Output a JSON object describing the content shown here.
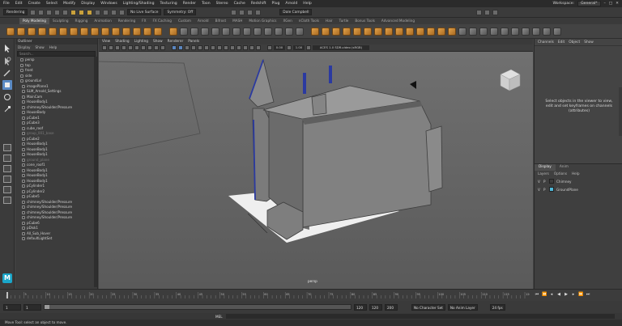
{
  "menubar": {
    "items": [
      "File",
      "Edit",
      "Create",
      "Select",
      "Modify",
      "Display",
      "Windows",
      "Lighting/Shading",
      "Texturing",
      "Render",
      "Toon",
      "Stereo",
      "Cache",
      "Redshift",
      "Plug",
      "Arnold",
      "Help"
    ],
    "workspace_label": "Workspace:",
    "workspace_value": "General*"
  },
  "statusline": {
    "mode": "Rendering",
    "live_surface": "No Live Surface",
    "symmetry": "Symmetry: Off",
    "user": "Dale Campbell"
  },
  "shelf_tabs": [
    "Poly Modeling",
    "Sculpting",
    "Rigging",
    "Animation",
    "Rendering",
    "FX",
    "FX Caching",
    "Custom",
    "Arnold",
    "Bifrost",
    "MASH",
    "Motion Graphics",
    "XGen",
    "nCloth Tools",
    "Hair",
    "Turtle",
    "Bonus Tools",
    "Advanced Modeling"
  ],
  "shelf_active_index": 0,
  "outliner": {
    "title": "Outliner",
    "menu": [
      "Display",
      "Show",
      "Help"
    ],
    "search_placeholder": "Search...",
    "items": [
      {
        "label": "persp",
        "dim": false
      },
      {
        "label": "top",
        "dim": false
      },
      {
        "label": "front",
        "dim": false
      },
      {
        "label": "side",
        "dim": false
      },
      {
        "label": "groundLvl",
        "dim": false
      },
      {
        "label": "imagePlane1",
        "dim": false
      },
      {
        "label": "SLM_Arnold_Settings",
        "dim": false
      },
      {
        "label": "MainCam",
        "dim": false
      },
      {
        "label": "HouseBody1",
        "dim": false
      },
      {
        "label": "chimney/Shoulder/Pressure",
        "dim": false
      },
      {
        "label": "HouseBody",
        "dim": false
      },
      {
        "label": "pCube1",
        "dim": false
      },
      {
        "label": "pCube3",
        "dim": false
      },
      {
        "label": "cube_roof",
        "dim": false
      },
      {
        "label": "group_001_base",
        "dim": true
      },
      {
        "label": "pCube2",
        "dim": false
      },
      {
        "label": "HouseBody1",
        "dim": false
      },
      {
        "label": "HouseBody1",
        "dim": false
      },
      {
        "label": "HouseBody1",
        "dim": false
      },
      {
        "label": "ground_plane",
        "dim": true
      },
      {
        "label": "cone_roof1",
        "dim": false
      },
      {
        "label": "HouseBody1",
        "dim": false
      },
      {
        "label": "HouseBody1",
        "dim": false
      },
      {
        "label": "HouseBody1",
        "dim": false
      },
      {
        "label": "pCylinder1",
        "dim": false
      },
      {
        "label": "pCylinder2",
        "dim": false
      },
      {
        "label": "pCube5",
        "dim": false
      },
      {
        "label": "chimney/Shoulder/Pressure",
        "dim": false
      },
      {
        "label": "chimney/Shoulder/Pressure",
        "dim": false
      },
      {
        "label": "chimney/Shoulder/Pressure",
        "dim": false
      },
      {
        "label": "chimney/Shoulder/Pressure",
        "dim": false
      },
      {
        "label": "pCube6",
        "dim": false
      },
      {
        "label": "pDisk1",
        "dim": false
      },
      {
        "label": "All_Sub_Hover",
        "dim": false
      },
      {
        "label": "defaultLightSet",
        "dim": false
      }
    ]
  },
  "viewport": {
    "menu": [
      "View",
      "Shading",
      "Lighting",
      "Show",
      "Renderer",
      "Panels"
    ],
    "field_exposure": "0.00",
    "field_gamma": "1.00",
    "color_space": "ACES 1.0 SDR-video (sRGB)",
    "camera_label": "persp"
  },
  "channelbox": {
    "menu": [
      "Channels",
      "Edit",
      "Object",
      "Show"
    ],
    "message": "Select objects in the viewer to view, edit and set keyframes on channels (attributes)"
  },
  "layers": {
    "tabs": [
      "Display",
      "Anim"
    ],
    "menu": [
      "Layers",
      "Options",
      "Help"
    ],
    "rows": [
      {
        "v": "V",
        "p": "P",
        "name": "Chimney",
        "color": "#3c3c3c"
      },
      {
        "v": "V",
        "p": "P",
        "name": "GroundPlane",
        "color": "#4fb8d9"
      }
    ]
  },
  "timeline": {
    "ticks": [
      "5",
      "10",
      "15",
      "20",
      "25",
      "30",
      "35",
      "40",
      "45",
      "50",
      "55",
      "60",
      "65",
      "70",
      "75",
      "80",
      "85",
      "90",
      "95",
      "100",
      "105",
      "110",
      "115",
      "120"
    ]
  },
  "range": {
    "start": "1",
    "start2": "1",
    "end": "120",
    "end2": "120",
    "end3": "200",
    "character_set": "No Character Set",
    "anim_layer": "No Anim Layer",
    "fps": "24 fps"
  },
  "cmdline": {
    "lang": "MEL"
  },
  "help_text": "Move Tool: select an object to move."
}
